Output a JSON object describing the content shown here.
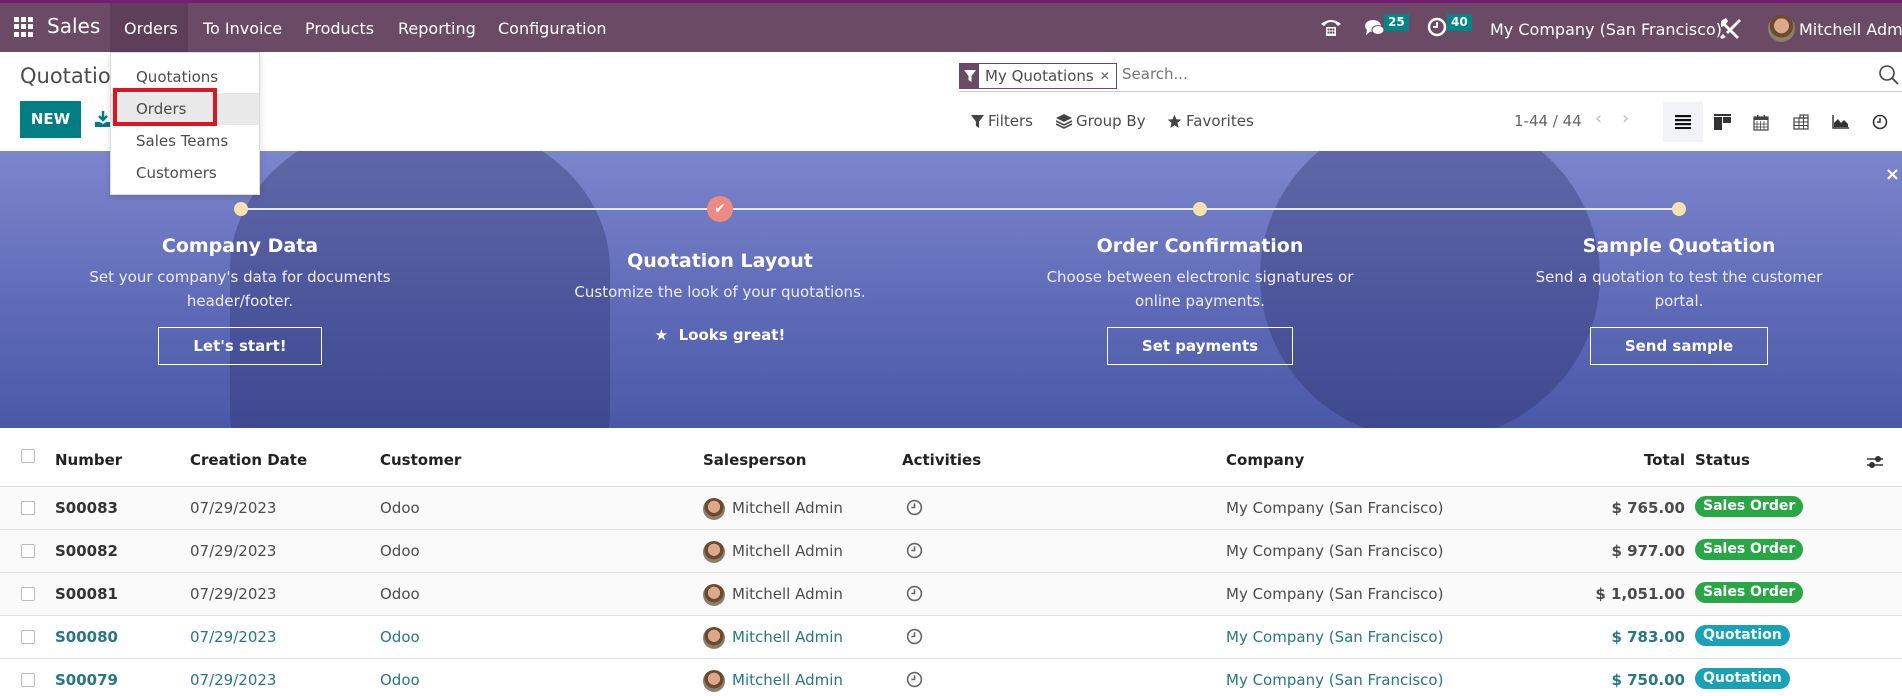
{
  "navbar": {
    "app_name": "Sales",
    "menu": [
      "Orders",
      "To Invoice",
      "Products",
      "Reporting",
      "Configuration"
    ],
    "messages_count": "25",
    "activities_count": "40",
    "company": "My Company (San Francisco)",
    "user": "Mitchell Admin"
  },
  "control_panel": {
    "title": "Quotations",
    "new_label": "NEW",
    "search": {
      "facet": "My Quotations",
      "placeholder": "Search..."
    },
    "filters_label": "Filters",
    "groupby_label": "Group By",
    "favorites_label": "Favorites",
    "pager": "1-44 / 44",
    "views": [
      "list",
      "kanban",
      "calendar",
      "pivot",
      "graph",
      "activity"
    ],
    "active_view": "list"
  },
  "dropdown": {
    "items": [
      "Quotations",
      "Orders",
      "Sales Teams",
      "Customers"
    ],
    "highlighted": "Orders"
  },
  "banner": {
    "steps": [
      {
        "title": "Company Data",
        "desc": "Set your company's data for documents header/footer.",
        "button": "Let's start!",
        "done": false
      },
      {
        "title": "Quotation Layout",
        "desc": "Customize the look of your quotations.",
        "button": "Looks great!",
        "done": true
      },
      {
        "title": "Order Confirmation",
        "desc": "Choose between electronic signatures or online payments.",
        "button": "Set payments",
        "done": false
      },
      {
        "title": "Sample Quotation",
        "desc": "Send a quotation to test the customer portal.",
        "button": "Send sample",
        "done": false
      }
    ],
    "close": "×"
  },
  "table": {
    "columns": [
      "Number",
      "Creation Date",
      "Customer",
      "Salesperson",
      "Activities",
      "Company",
      "Total",
      "Status"
    ],
    "rows": [
      {
        "number": "S00083",
        "date": "07/29/2023",
        "customer": "Odoo",
        "salesperson": "Mitchell Admin",
        "company": "My Company (San Francisco)",
        "total": "$ 765.00",
        "status": "Sales Order"
      },
      {
        "number": "S00082",
        "date": "07/29/2023",
        "customer": "Odoo",
        "salesperson": "Mitchell Admin",
        "company": "My Company (San Francisco)",
        "total": "$ 977.00",
        "status": "Sales Order"
      },
      {
        "number": "S00081",
        "date": "07/29/2023",
        "customer": "Odoo",
        "salesperson": "Mitchell Admin",
        "company": "My Company (San Francisco)",
        "total": "$ 1,051.00",
        "status": "Sales Order"
      },
      {
        "number": "S00080",
        "date": "07/29/2023",
        "customer": "Odoo",
        "salesperson": "Mitchell Admin",
        "company": "My Company (San Francisco)",
        "total": "$ 783.00",
        "status": "Quotation"
      },
      {
        "number": "S00079",
        "date": "07/29/2023",
        "customer": "Odoo",
        "salesperson": "Mitchell Admin",
        "company": "My Company (San Francisco)",
        "total": "$ 750.00",
        "status": "Quotation"
      }
    ]
  },
  "colors": {
    "navbar": "#6b4a65",
    "primary": "#017e84",
    "sales_order_badge": "#28a745",
    "quotation_badge": "#17a2b8",
    "highlight_box": "#e0141e"
  }
}
